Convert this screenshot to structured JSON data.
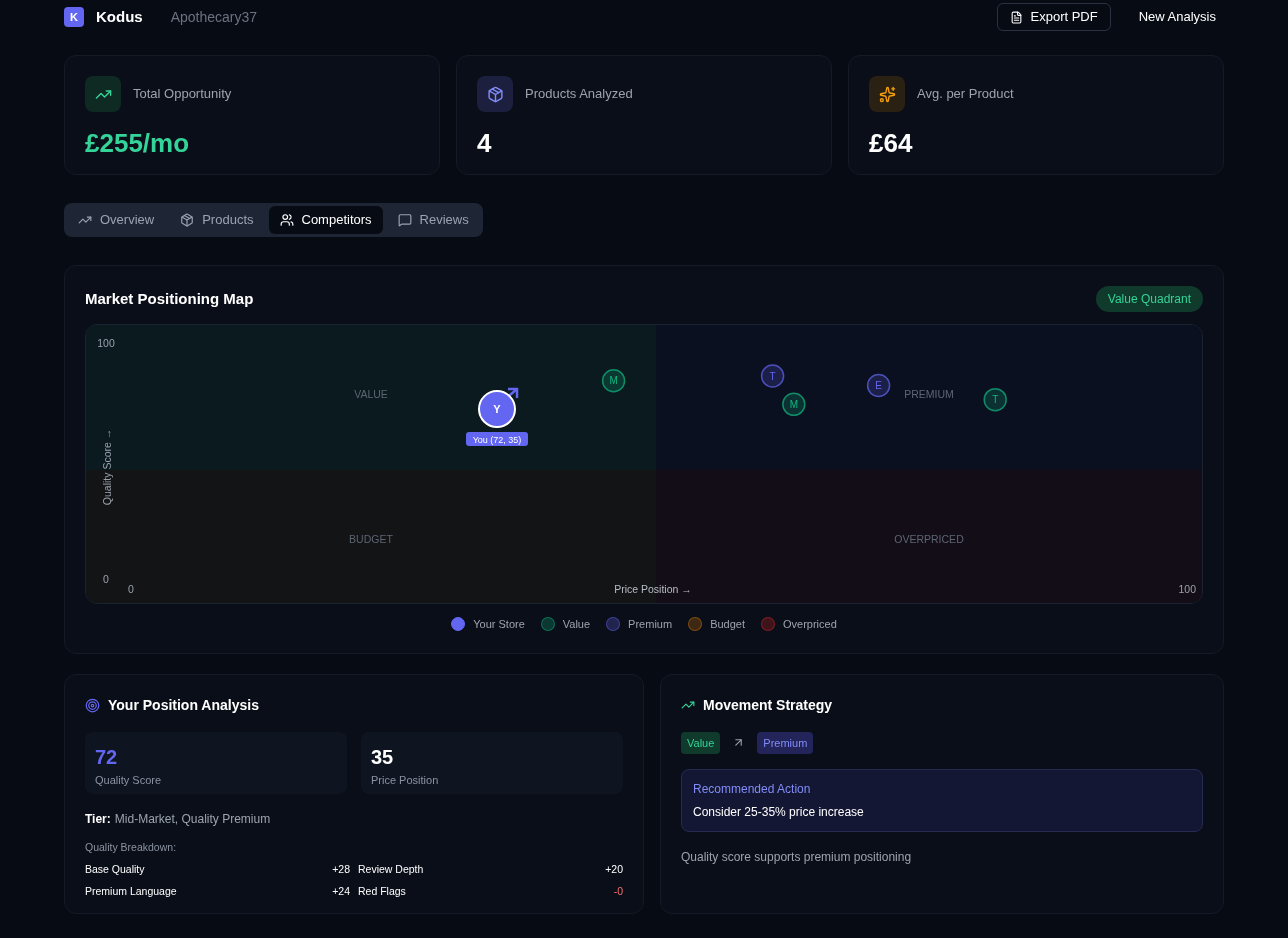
{
  "header": {
    "logo_letter": "K",
    "brand": "Kodus",
    "store": "Apothecary37",
    "actions": [
      {
        "label": "Export PDF",
        "kind": "outline"
      },
      {
        "label": "New Analysis",
        "kind": "plain"
      }
    ]
  },
  "stats": [
    {
      "label": "Total Opportunity",
      "value": "£255/mo",
      "kind": "positive"
    },
    {
      "label": "Products Analyzed",
      "value": "4",
      "kind": "plain"
    },
    {
      "label": "Avg. per Product",
      "value": "£64",
      "kind": "plain"
    }
  ],
  "tabs": [
    {
      "label": "Overview",
      "selected": false
    },
    {
      "label": "Products",
      "selected": false
    },
    {
      "label": "Competitors",
      "selected": true
    },
    {
      "label": "Reviews",
      "selected": false
    }
  ],
  "map": {
    "title": "Market Positioning Map",
    "badge": "Value Quadrant",
    "quadrants": [
      {
        "label": "VALUE",
        "kind": "value"
      },
      {
        "label": "PREMIUM",
        "kind": "premium"
      },
      {
        "label": "BUDGET",
        "kind": "budget"
      },
      {
        "label": "OVERPRICED",
        "kind": "overpriced"
      }
    ],
    "chart_data": {
      "type": "scatter",
      "xlabel": "Price Position →",
      "ylabel": "Quality Score →",
      "xlim": [
        0,
        100
      ],
      "ylim": [
        0,
        100
      ],
      "xticks": [
        {
          "value": 0,
          "label": "0"
        },
        {
          "value": 100,
          "label": "100"
        }
      ],
      "yticks": [
        {
          "value": 0,
          "label": "0"
        },
        {
          "value": 100,
          "label": "100"
        }
      ],
      "x": [
        35,
        46,
        61,
        63,
        71,
        82
      ],
      "series": [
        {
          "name": "Your Store",
          "color": "#6366f1",
          "values": [
            72,
            null,
            null,
            null,
            null,
            null
          ]
        },
        {
          "name": "Value",
          "color": "#10b981",
          "values": [
            null,
            84,
            null,
            74,
            null,
            76
          ]
        },
        {
          "name": "Premium",
          "color": "#6366f1",
          "values": [
            null,
            null,
            86,
            null,
            82,
            null
          ]
        },
        {
          "name": "Budget",
          "color": "#d97706",
          "values": [
            null,
            null,
            null,
            null,
            null,
            null
          ]
        },
        {
          "name": "Overpriced",
          "color": "#dc2626",
          "values": [
            null,
            null,
            null,
            null,
            null,
            null
          ]
        }
      ],
      "annotations": [
        {
          "x": 35,
          "y": 72,
          "text": "Y"
        },
        {
          "x": 35,
          "y": 72,
          "text": "You (72, 35)"
        },
        {
          "x": 46,
          "y": 84,
          "text": "M"
        },
        {
          "x": 61,
          "y": 86,
          "text": "T"
        },
        {
          "x": 63,
          "y": 74,
          "text": "M"
        },
        {
          "x": 71,
          "y": 82,
          "text": "E"
        },
        {
          "x": 82,
          "y": 76,
          "text": "T"
        }
      ]
    }
  },
  "position": {
    "title": "Your Position Analysis",
    "metrics": [
      {
        "value": "72",
        "label": "Quality Score",
        "kind": "accent"
      },
      {
        "value": "35",
        "label": "Price Position",
        "kind": "plain"
      }
    ],
    "tier_label": "Tier:",
    "tier": "Mid-Market, Quality Premium",
    "breakdown_title": "Quality Breakdown:",
    "breakdown": [
      {
        "label": "Base Quality",
        "value": "+28",
        "kind": "plain"
      },
      {
        "label": "Review Depth",
        "value": "+20",
        "kind": "plain"
      },
      {
        "label": "Premium Language",
        "value": "+24",
        "kind": "plain"
      },
      {
        "label": "Red Flags",
        "value": "-0",
        "kind": "negative"
      }
    ]
  },
  "strategy": {
    "title": "Movement Strategy",
    "from": "Value",
    "to": "Premium",
    "action_title": "Recommended Action",
    "action": "Consider 25-35% price increase",
    "note": "Quality score supports premium positioning"
  }
}
